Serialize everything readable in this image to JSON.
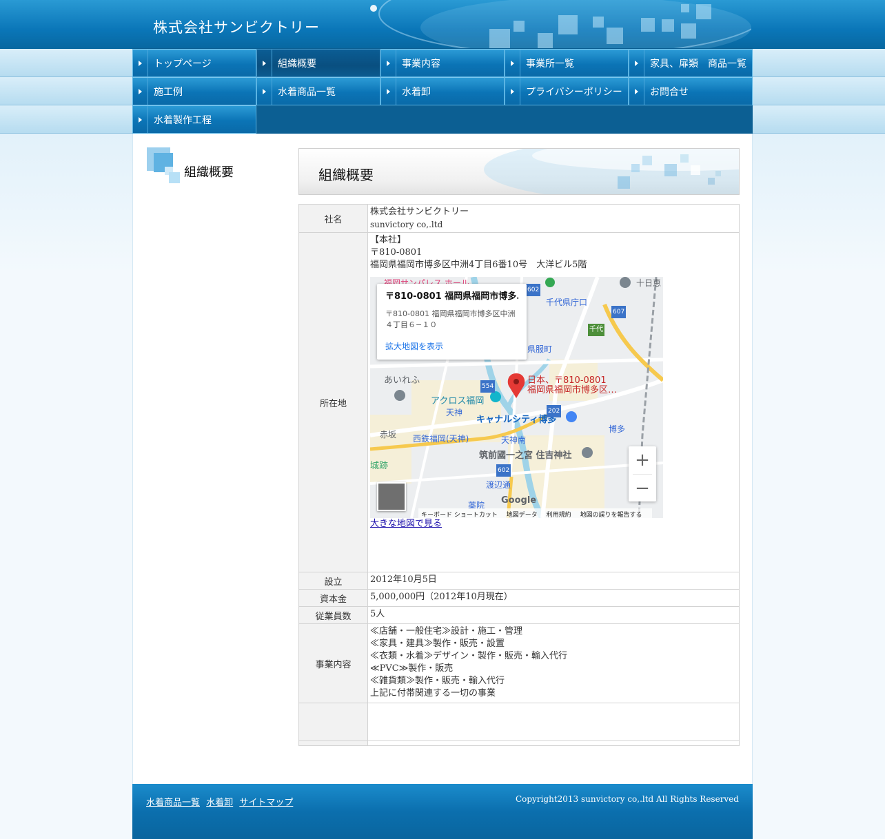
{
  "site": {
    "title": "株式会社サンビクトリー"
  },
  "nav": {
    "rows": [
      [
        {
          "label": "トップページ",
          "active": false
        },
        {
          "label": "組織概要",
          "active": true
        },
        {
          "label": "事業内容",
          "active": false
        },
        {
          "label": "事業所一覧",
          "active": false
        },
        {
          "label": "家具、扉類　商品一覧",
          "active": false
        }
      ],
      [
        {
          "label": "施工例",
          "active": false
        },
        {
          "label": "水着商品一覧",
          "active": false
        },
        {
          "label": "水着卸",
          "active": false
        },
        {
          "label": "プライバシーポリシー",
          "active": false
        },
        {
          "label": "お問合せ",
          "active": false
        }
      ],
      [
        {
          "label": "水着製作工程",
          "active": false
        }
      ]
    ]
  },
  "sidebar": {
    "title": "組織概要"
  },
  "page": {
    "heading": "組織概要"
  },
  "company": {
    "name_label": "社名",
    "name_jp": "株式会社サンビクトリー",
    "name_en": "sunvictory co,.ltd",
    "address_label": "所在地",
    "address_head": "【本社】",
    "postal": "〒810-0801",
    "address": "福岡県福岡市博多区中洲4丁目6番10号　大洋ビル5階",
    "map_link": "大きな地図で見る",
    "founded_label": "設立",
    "founded": "2012年10月5日",
    "capital_label": "資本金",
    "capital": "5,000,000円（2012年10月現在）",
    "employees_label": "従業員数",
    "employees": "5人",
    "business_label": "事業内容",
    "business_lines": [
      "≪店舗・一般住宅≫設計・施工・管理",
      "≪家具・建具≫製作・販売・設置",
      "≪衣類・水着≫デザイン・製作・販売・輸入代行",
      "≪PVC≫製作・販売",
      "≪雑貨類≫製作・販売・輸入代行",
      "上記に付帯関連する一切の事業"
    ]
  },
  "map": {
    "info_title": "〒810-0801 福岡県福岡市博多...",
    "info_address_1": "〒810-0801 福岡県福岡市博多区中洲",
    "info_address_2": "４丁目６−１０",
    "info_link": "拡大地図を表示",
    "pin_label_1": "日本、〒810-0801",
    "pin_label_2": "福岡県福岡市博多区…",
    "zoom_in": "+",
    "zoom_out": "−",
    "google": "Google",
    "footer": {
      "shortcuts": "キーボード ショートカット",
      "data": "地図データ",
      "terms": "利用規約",
      "report": "地図の誤りを報告する"
    },
    "places": {
      "chiyo_office": "千代県庁口",
      "chiyo": "千代",
      "gofukumachi": "県服町",
      "aireru": "あいれふ",
      "acros": "アクロス福岡",
      "tenjin": "天神",
      "canal": "キャナルシティ博多",
      "akasaka": "赤坂",
      "nishitetsu": "西鉄福岡(天神)",
      "tenjin_minami": "天神南",
      "hakata": "博多",
      "sumiyoshi": "筑前國一之宮 住吉神社",
      "shiro": "城跡",
      "watanabe": "渡辺通",
      "yakuin": "薬院",
      "jujien": "十日恵",
      "route_602": "602",
      "route_607": "607",
      "route_554": "554",
      "route_202": "202",
      "route_602b": "602",
      "sunpalace": "福岡サンパレス ホール"
    }
  },
  "footer": {
    "links": [
      "水着商品一覧",
      "水着卸",
      "サイトマップ"
    ],
    "copyright": "Copyright2013 sunvictory co,.ltd All Rights Reserved"
  },
  "colors": {
    "header_blue": "#0a76b8",
    "nav_active": "#094f80",
    "table_head_bg": "#f2f2f2",
    "link_blue": "#1a0dab",
    "map_pin": "#e53935"
  }
}
